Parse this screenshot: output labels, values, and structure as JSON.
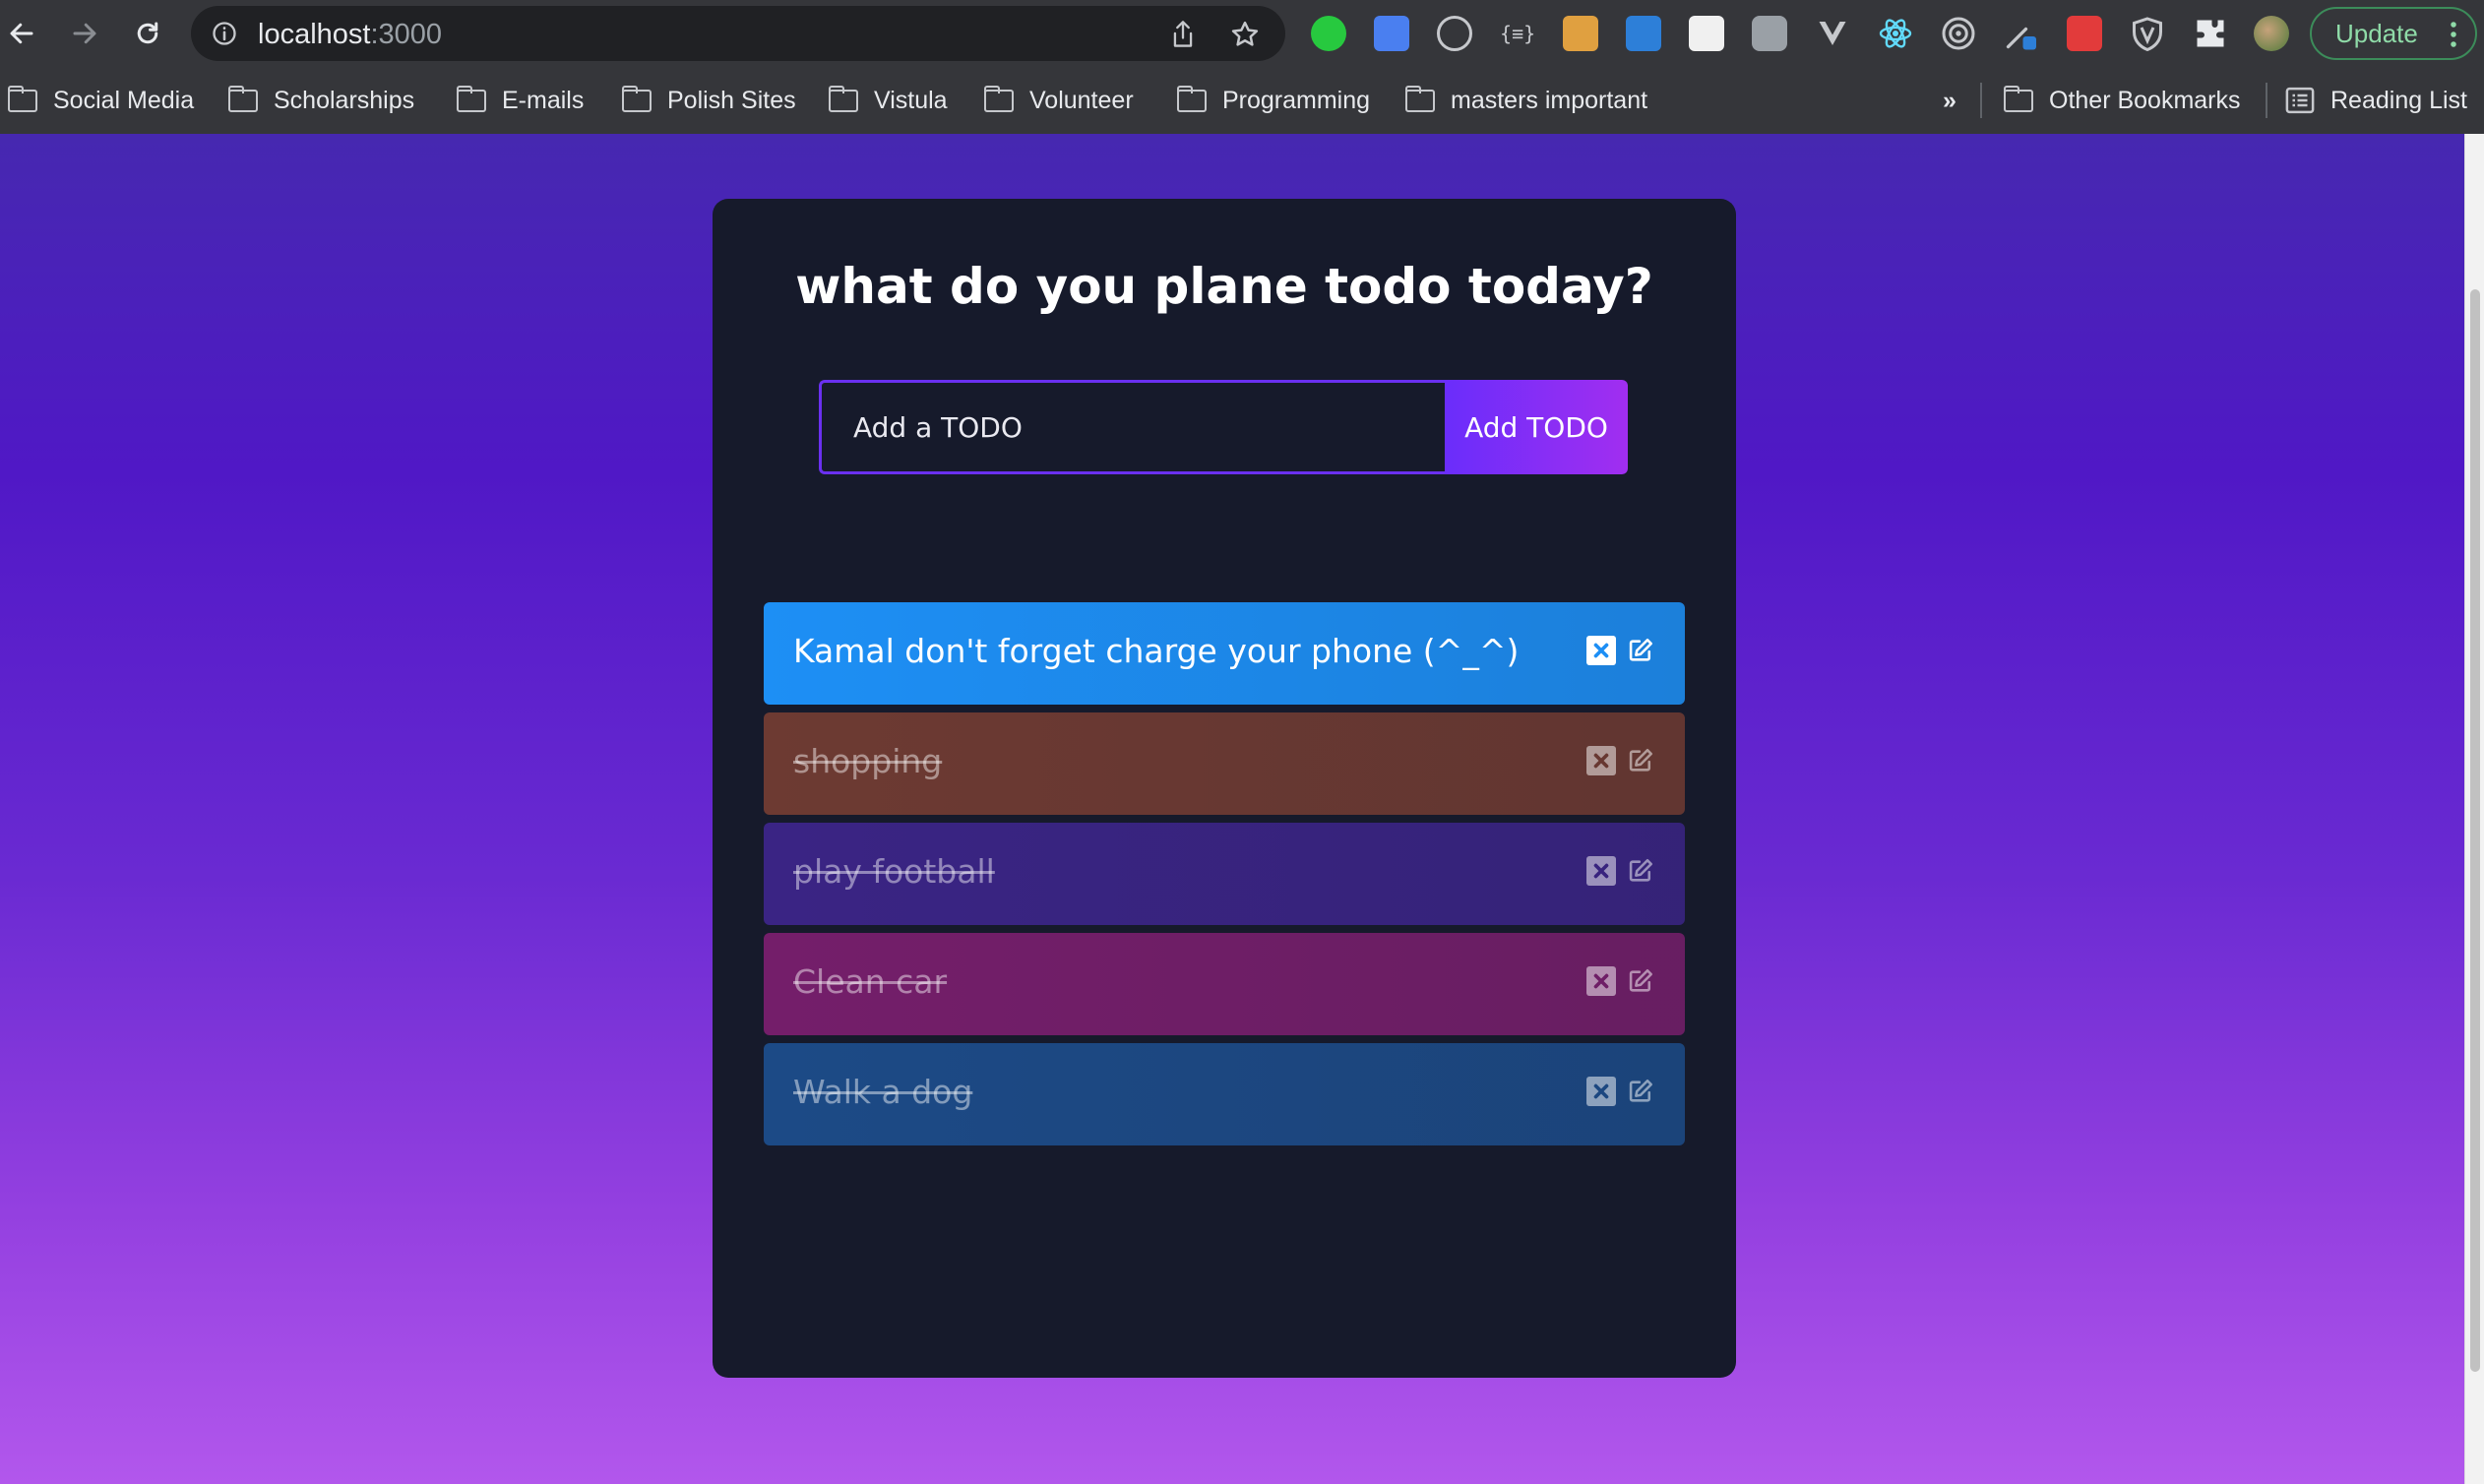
{
  "browser": {
    "url_host": "localhost",
    "url_port": ":3000",
    "update_label": "Update",
    "bookmarks": [
      {
        "label": "Social Media"
      },
      {
        "label": "Scholarships"
      },
      {
        "label": "E-mails"
      },
      {
        "label": "Polish Sites"
      },
      {
        "label": "Vistula"
      },
      {
        "label": "Volunteer"
      },
      {
        "label": "Programming"
      },
      {
        "label": "masters important"
      }
    ],
    "overflow_label": "»",
    "other_bookmarks": "Other Bookmarks",
    "reading_list": "Reading List"
  },
  "app": {
    "title": "what do you plane todo today?",
    "input_placeholder": "Add a TODO",
    "add_button": "Add TODO",
    "todos": [
      {
        "text": "Kamal don't forget charge your phone (^_^)",
        "completed": false,
        "color": "#1d8ff5"
      },
      {
        "text": "shopping",
        "completed": true,
        "color": "#6d3a32"
      },
      {
        "text": "play football",
        "completed": true,
        "color": "#3a2484"
      },
      {
        "text": "Clean car",
        "completed": true,
        "color": "#741e6a"
      },
      {
        "text": "Walk a dog",
        "completed": true,
        "color": "#1c4a86"
      }
    ]
  }
}
